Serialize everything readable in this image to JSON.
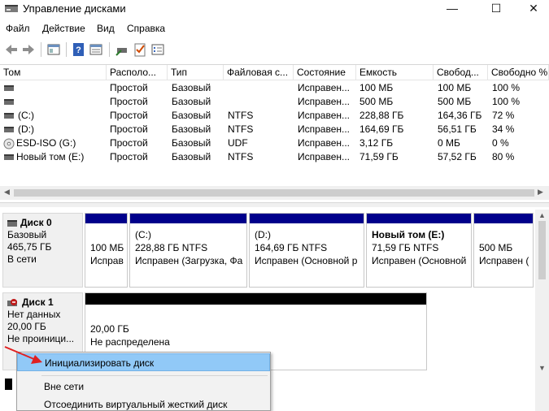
{
  "window": {
    "title": "Управление дисками",
    "min_glyph": "—",
    "max_glyph": "☐",
    "close_glyph": "✕"
  },
  "menu": {
    "file": "Файл",
    "action": "Действие",
    "view": "Вид",
    "help": "Справка"
  },
  "volumes": {
    "columns": [
      "Том",
      "Располо...",
      "Тип",
      "Файловая с...",
      "Состояние",
      "Емкость",
      "Свобод...",
      "Свободно %"
    ],
    "rows": [
      {
        "name": "",
        "layout": "Простой",
        "type": "Базовый",
        "fs": "",
        "status": "Исправен...",
        "capacity": "100 МБ",
        "free": "100 МБ",
        "free_pct": "100 %",
        "icon": "disk-volume-icon"
      },
      {
        "name": "",
        "layout": "Простой",
        "type": "Базовый",
        "fs": "",
        "status": "Исправен...",
        "capacity": "500 МБ",
        "free": "500 МБ",
        "free_pct": "100 %",
        "icon": "disk-volume-icon"
      },
      {
        "name": "(C:)",
        "layout": "Простой",
        "type": "Базовый",
        "fs": "NTFS",
        "status": "Исправен...",
        "capacity": "228,88 ГБ",
        "free": "164,36 ГБ",
        "free_pct": "72 %",
        "icon": "disk-volume-icon"
      },
      {
        "name": "(D:)",
        "layout": "Простой",
        "type": "Базовый",
        "fs": "NTFS",
        "status": "Исправен...",
        "capacity": "164,69 ГБ",
        "free": "56,51 ГБ",
        "free_pct": "34 %",
        "icon": "disk-volume-icon"
      },
      {
        "name": "ESD-ISO (G:)",
        "layout": "Простой",
        "type": "Базовый",
        "fs": "UDF",
        "status": "Исправен...",
        "capacity": "3,12 ГБ",
        "free": "0 МБ",
        "free_pct": "0 %",
        "icon": "cd-icon"
      },
      {
        "name": "Новый том (E:)",
        "layout": "Простой",
        "type": "Базовый",
        "fs": "NTFS",
        "status": "Исправен...",
        "capacity": "71,59 ГБ",
        "free": "57,52 ГБ",
        "free_pct": "80 %",
        "icon": "disk-volume-icon"
      }
    ]
  },
  "disk0": {
    "name": "Диск 0",
    "kind": "Базовый",
    "size": "465,75 ГБ",
    "state": "В сети",
    "partitions": [
      {
        "title": "",
        "size": "100 МБ",
        "status": "Исправ"
      },
      {
        "title": "(C:)",
        "size": "228,88 ГБ NTFS",
        "status": "Исправен (Загрузка, Фа"
      },
      {
        "title": "(D:)",
        "size": "164,69 ГБ NTFS",
        "status": "Исправен (Основной р"
      },
      {
        "title": "Новый том  (E:)",
        "size": "71,59 ГБ NTFS",
        "status": "Исправен (Основной"
      },
      {
        "title": "",
        "size": "500 МБ",
        "status": "Исправен ("
      }
    ]
  },
  "disk1": {
    "name": "Диск 1",
    "kind": "Нет данных",
    "size": "20,00 ГБ",
    "state": "Не проиници...",
    "partition": {
      "size": "20,00 ГБ",
      "status": "Не распределена"
    }
  },
  "context_menu": {
    "items": [
      "Инициализировать диск",
      "Вне сети",
      "Отсоединить виртуальный жесткий диск"
    ]
  },
  "colors": {
    "primary_partition": "#00008b",
    "unallocated": "#000000",
    "selection": "#91c9f7",
    "annotation_arrow": "#e02020"
  }
}
